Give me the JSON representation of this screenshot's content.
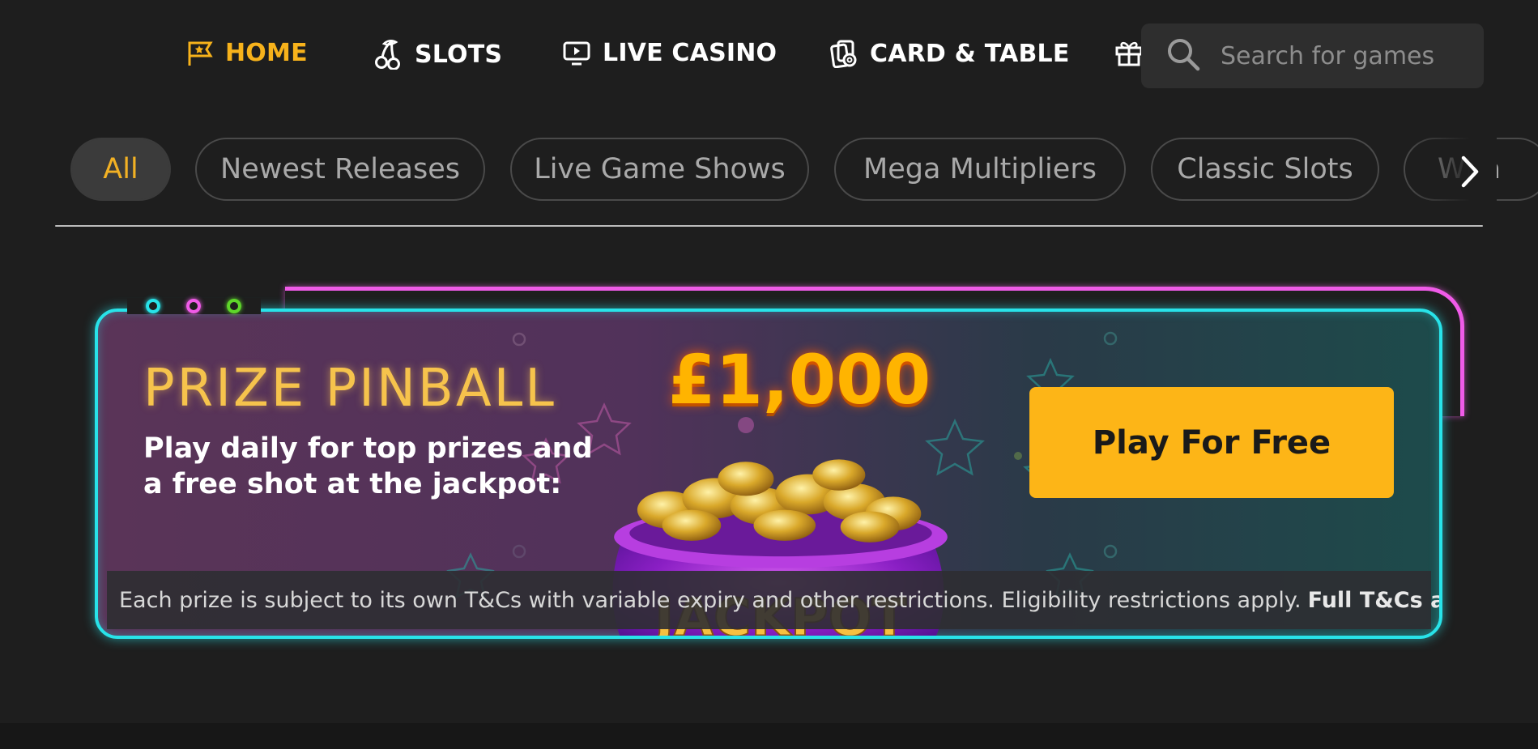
{
  "nav": {
    "items": [
      {
        "label": "HOME",
        "icon": "flag-star-icon",
        "active": true
      },
      {
        "label": "SLOTS",
        "icon": "cherries-icon",
        "active": false
      },
      {
        "label": "LIVE CASINO",
        "icon": "monitor-play-icon",
        "active": false
      },
      {
        "label": "CARD & TABLE",
        "icon": "cards-chip-icon",
        "active": false
      },
      {
        "label": "",
        "icon": "gift-icon",
        "active": false
      }
    ],
    "search_placeholder": "Search for games"
  },
  "categories": {
    "chips": [
      "All",
      "Newest Releases",
      "Live Game Shows",
      "Mega Multipliers",
      "Classic Slots",
      "Wha"
    ],
    "selected": "All"
  },
  "banner": {
    "title": "PRIZE PINBALL",
    "subtitle": "Play daily for top prizes and a free shot at the jackpot:",
    "prize": "£1,000",
    "pot_label": "JACKPOT",
    "cta_label": "Play For Free",
    "disclaimer": "Each prize is subject to its own T&Cs with variable expiry and other restrictions. Eligibility restrictions apply.",
    "disclaimer_link": "Full T&Cs apply."
  },
  "colors": {
    "accent": "#f7b21b",
    "neon_cyan": "#28e3e9",
    "neon_pink": "#f05be8",
    "neon_green": "#5ed62a",
    "cta": "#fdb517",
    "background": "#1e1e1e"
  }
}
